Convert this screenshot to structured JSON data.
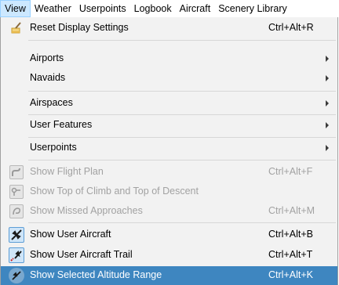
{
  "menubar": {
    "items": [
      {
        "label": "View"
      },
      {
        "label": "Weather"
      },
      {
        "label": "Userpoints"
      },
      {
        "label": "Logbook"
      },
      {
        "label": "Aircraft"
      },
      {
        "label": "Scenery Library"
      }
    ]
  },
  "menu": {
    "items": [
      {
        "label": "Reset Display Settings",
        "shortcut": "Ctrl+Alt+R",
        "icon": "brush-icon"
      },
      {
        "label": "Airports",
        "submenu": true
      },
      {
        "label": "Navaids",
        "submenu": true
      },
      {
        "label": "Airspaces",
        "submenu": true
      },
      {
        "label": "User Features",
        "submenu": true
      },
      {
        "label": "Userpoints",
        "submenu": true
      },
      {
        "label": "Show Flight Plan",
        "shortcut": "Ctrl+Alt+F",
        "icon": "flight-plan-icon",
        "disabled": true
      },
      {
        "label": "Show Top of Climb and Top of Descent",
        "icon": "top-of-climb-icon",
        "disabled": true
      },
      {
        "label": "Show Missed Approaches",
        "shortcut": "Ctrl+Alt+M",
        "icon": "missed-approach-icon",
        "disabled": true
      },
      {
        "label": "Show User Aircraft",
        "shortcut": "Ctrl+Alt+B",
        "icon": "user-aircraft-icon",
        "checked": true
      },
      {
        "label": "Show User Aircraft Trail",
        "shortcut": "Ctrl+Alt+T",
        "icon": "aircraft-trail-icon",
        "checked": true
      },
      {
        "label": "Show Selected Altitude Range",
        "shortcut": "Ctrl+Alt+K",
        "icon": "altitude-range-icon",
        "checked": true,
        "highlighted": true
      }
    ]
  },
  "colors": {
    "highlight": "#3e86c0",
    "disabled_text": "#a2a2a2",
    "menu_background": "#f2f2f2",
    "active_menubar": "#cce8ff"
  }
}
